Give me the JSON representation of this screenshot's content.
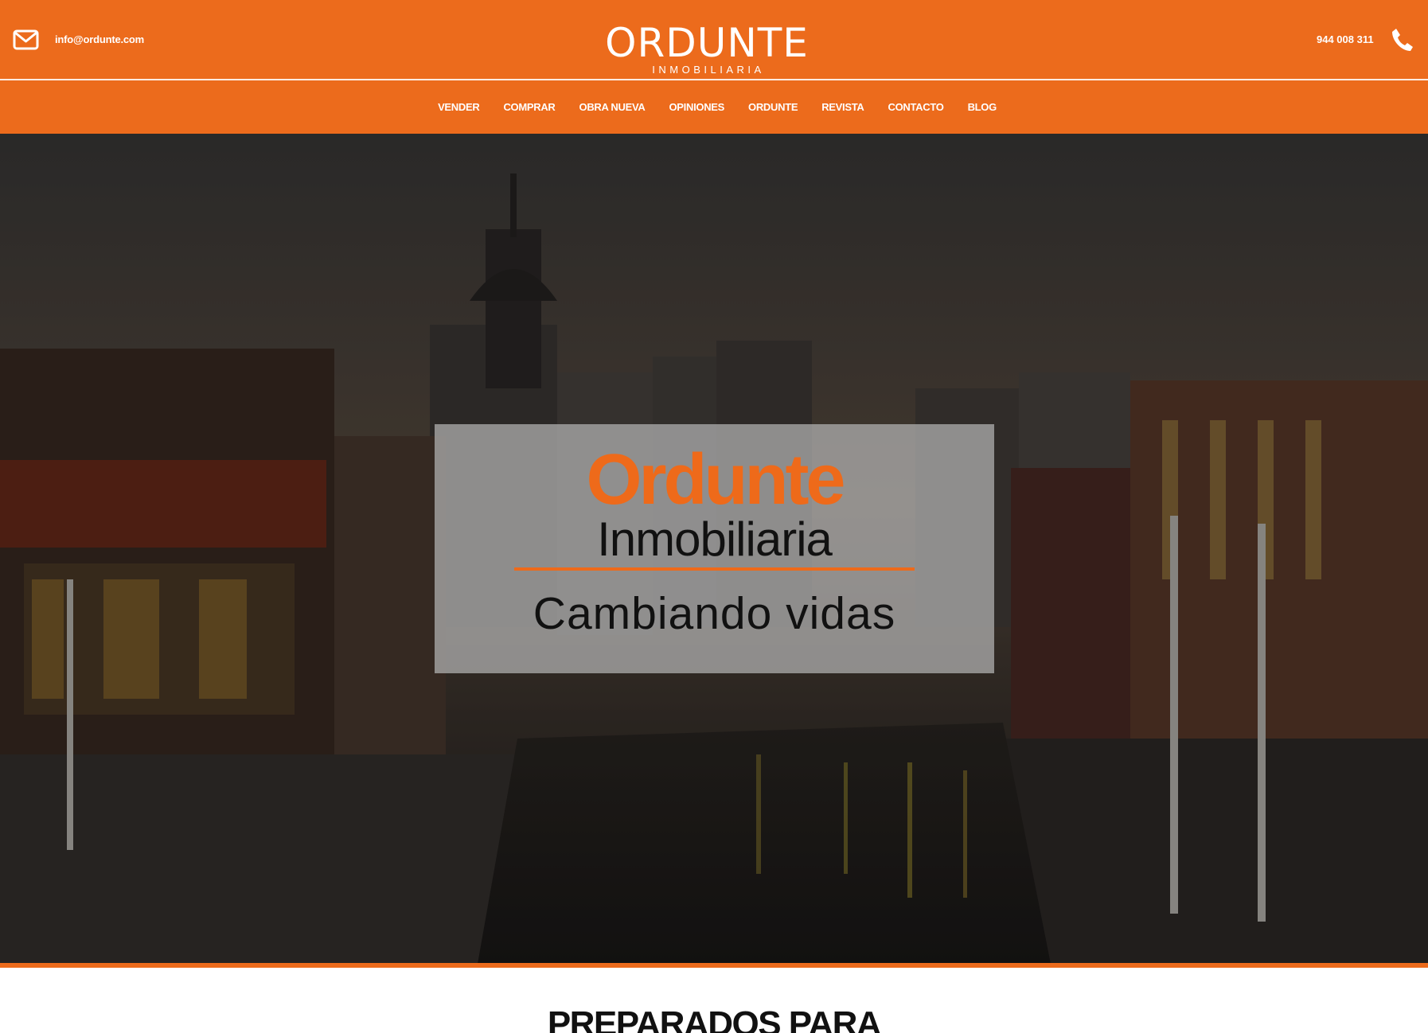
{
  "header": {
    "email": "info@ordunte.com",
    "phone": "944 008 311",
    "logo_name": "ORDUNTE",
    "logo_sub": "INMOBILIARIA",
    "icons": {
      "mail": "envelope-icon",
      "phone": "phone-icon"
    }
  },
  "nav": {
    "items": [
      {
        "label": "VENDER"
      },
      {
        "label": "COMPRAR"
      },
      {
        "label": "OBRA NUEVA"
      },
      {
        "label": "OPINIONES"
      },
      {
        "label": "ORDUNTE"
      },
      {
        "label": "REVISTA"
      },
      {
        "label": "CONTACTO"
      },
      {
        "label": "BLOG"
      }
    ]
  },
  "hero": {
    "brand": "Ordunte",
    "subtitle": "Inmobiliaria",
    "tagline": "Cambiando vidas"
  },
  "section": {
    "title": "PREPARADOS PARA"
  },
  "colors": {
    "accent": "#ec6b1c",
    "text_dark": "#111111",
    "white": "#ffffff"
  }
}
